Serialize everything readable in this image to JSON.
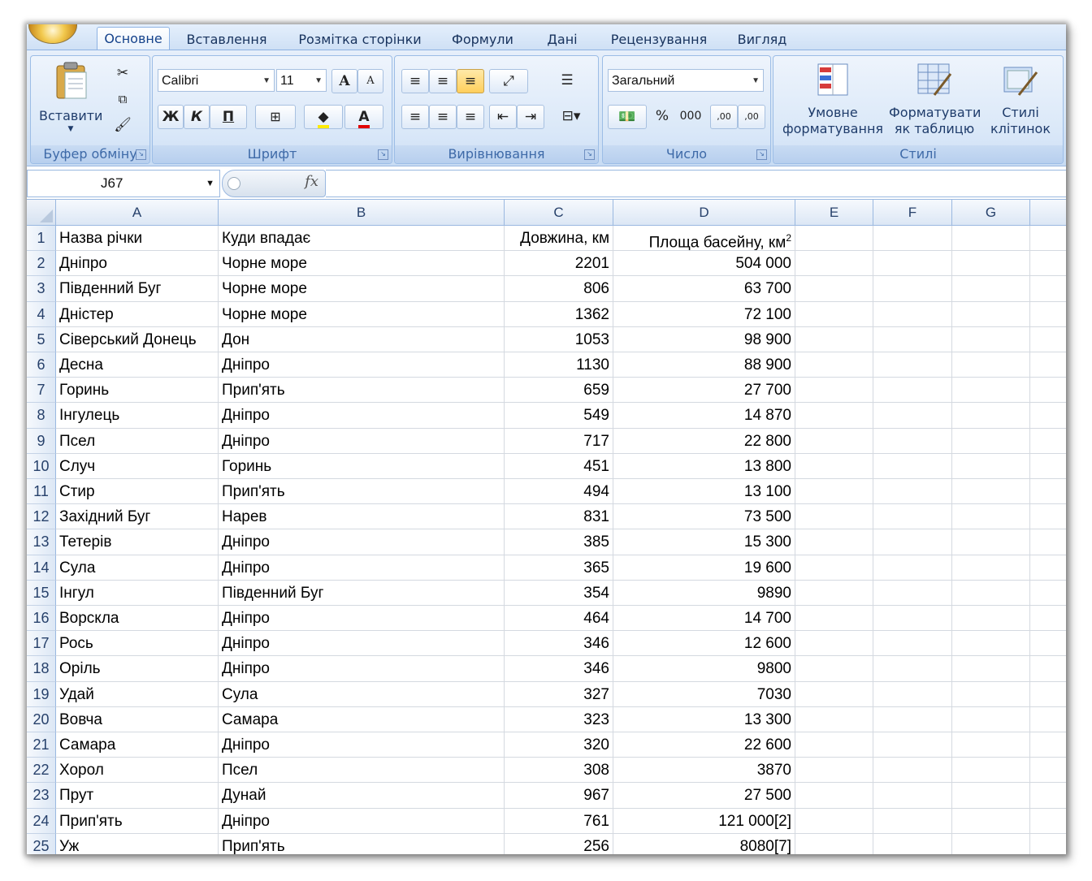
{
  "tabs": [
    "Основне",
    "Вставлення",
    "Розмітка сторінки",
    "Формули",
    "Дані",
    "Рецензування",
    "Вигляд"
  ],
  "ribbon": {
    "clipboard": {
      "paste_label": "Вставити",
      "group_label": "Буфер обміну"
    },
    "font": {
      "name": "Calibri",
      "size": "11",
      "bold": "Ж",
      "italic": "К",
      "underline": "П",
      "grow": "A",
      "shrink": "A",
      "color_glyph": "A",
      "group_label": "Шрифт"
    },
    "alignment": {
      "group_label": "Вирівнювання"
    },
    "number": {
      "format": "Загальний",
      "percent": "%",
      "thousands": "000",
      "inc_decimal": ",00",
      "dec_decimal": ",00",
      "group_label": "Число"
    },
    "styles": {
      "conditional_label_1": "Умовне",
      "conditional_label_2": "форматування",
      "table_label_1": "Форматувати",
      "table_label_2": "як таблицю",
      "cell_label_1": "Стилі",
      "cell_label_2": "клітинок",
      "group_label": "Стилі"
    }
  },
  "formula_bar": {
    "name_box": "J67",
    "fx": "fx",
    "content": ""
  },
  "columns": [
    "A",
    "B",
    "C",
    "D",
    "E",
    "F",
    "G"
  ],
  "rows": [
    {
      "n": "1",
      "a": "Назва річки",
      "b": "Куди впадає",
      "c": "Довжина, км",
      "d": "Площа басейну, км",
      "d_sup": "2"
    },
    {
      "n": "2",
      "a": "Дніпро",
      "b": "Чорне море",
      "c": "2201",
      "d": "504 000"
    },
    {
      "n": "3",
      "a": "Південний Буг",
      "b": "Чорне море",
      "c": "806",
      "d": "63 700"
    },
    {
      "n": "4",
      "a": "Дністер",
      "b": "Чорне море",
      "c": "1362",
      "d": "72 100"
    },
    {
      "n": "5",
      "a": "Сіверський Донець",
      "b": "Дон",
      "c": "1053",
      "d": "98 900"
    },
    {
      "n": "6",
      "a": "Десна",
      "b": "Дніпро",
      "c": "1130",
      "d": "88 900"
    },
    {
      "n": "7",
      "a": "Горинь",
      "b": "Прип'ять",
      "c": "659",
      "d": "27 700"
    },
    {
      "n": "8",
      "a": "Інгулець",
      "b": "Дніпро",
      "c": "549",
      "d": "14 870"
    },
    {
      "n": "9",
      "a": "Псел",
      "b": "Дніпро",
      "c": "717",
      "d": "22 800"
    },
    {
      "n": "10",
      "a": "Случ",
      "b": "Горинь",
      "c": "451",
      "d": "13 800"
    },
    {
      "n": "11",
      "a": "Стир",
      "b": "Прип'ять",
      "c": "494",
      "d": "13 100"
    },
    {
      "n": "12",
      "a": "Західний Буг",
      "b": "Нарев",
      "c": "831",
      "d": "73 500"
    },
    {
      "n": "13",
      "a": "Тетерів",
      "b": "Дніпро",
      "c": "385",
      "d": "15 300"
    },
    {
      "n": "14",
      "a": "Сула",
      "b": "Дніпро",
      "c": "365",
      "d": "19 600"
    },
    {
      "n": "15",
      "a": "Інгул",
      "b": "Південний Буг",
      "c": "354",
      "d": "9890"
    },
    {
      "n": "16",
      "a": "Ворскла",
      "b": "Дніпро",
      "c": "464",
      "d": "14 700"
    },
    {
      "n": "17",
      "a": "Рось",
      "b": "Дніпро",
      "c": "346",
      "d": "12 600"
    },
    {
      "n": "18",
      "a": "Оріль",
      "b": "Дніпро",
      "c": "346",
      "d": "9800"
    },
    {
      "n": "19",
      "a": "Удай",
      "b": "Сула",
      "c": "327",
      "d": "7030"
    },
    {
      "n": "20",
      "a": "Вовча",
      "b": "Самара",
      "c": "323",
      "d": "13 300"
    },
    {
      "n": "21",
      "a": "Самара",
      "b": "Дніпро",
      "c": "320",
      "d": "22 600"
    },
    {
      "n": "22",
      "a": "Хорол",
      "b": "Псел",
      "c": "308",
      "d": "3870"
    },
    {
      "n": "23",
      "a": "Прут",
      "b": "Дунай",
      "c": "967",
      "d": "27 500"
    },
    {
      "n": "24",
      "a": "Прип'ять",
      "b": "Дніпро",
      "c": "761",
      "d": "121 000[2]"
    },
    {
      "n": "25",
      "a": "Уж",
      "b": "Прип'ять",
      "c": "256",
      "d": "8080[7]"
    }
  ]
}
